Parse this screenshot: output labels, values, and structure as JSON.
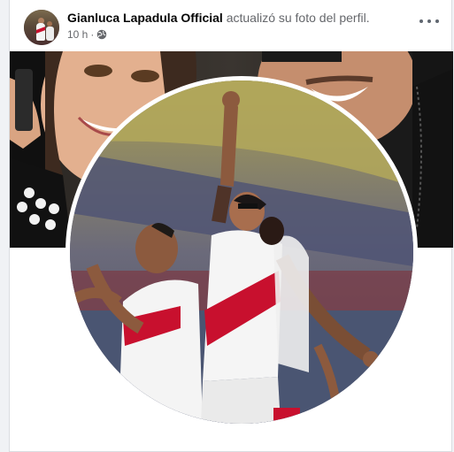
{
  "post": {
    "author": "Gianluca Lapadula Official",
    "action": "actualizó su foto del perfil.",
    "time": "10 h",
    "separator": "·",
    "audience_icon": "globe-icon",
    "more_icon": "more-options-icon"
  },
  "colors": {
    "card_bg": "#ffffff",
    "page_bg": "#f0f2f5",
    "author_text": "#050505",
    "secondary_text": "#65676b",
    "jersey_red": "#c8102e"
  }
}
